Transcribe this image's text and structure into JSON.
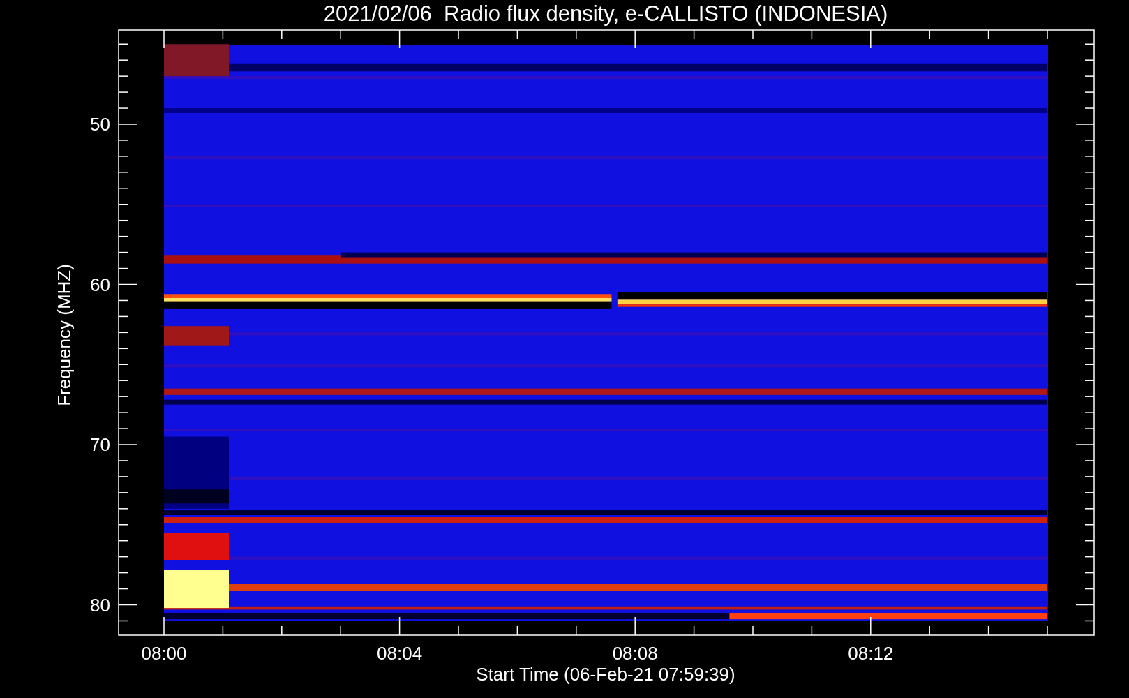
{
  "title": "2021/02/06  Radio flux density, e-CALLISTO (INDONESIA)",
  "x_axis": {
    "label": "Start Time (06-Feb-21 07:59:39)",
    "tick_labels": [
      "08:00",
      "08:04",
      "08:08",
      "08:12"
    ]
  },
  "y_axis": {
    "label": "Frequency (MHZ)",
    "tick_labels": [
      "50",
      "60",
      "70",
      "80"
    ]
  }
}
